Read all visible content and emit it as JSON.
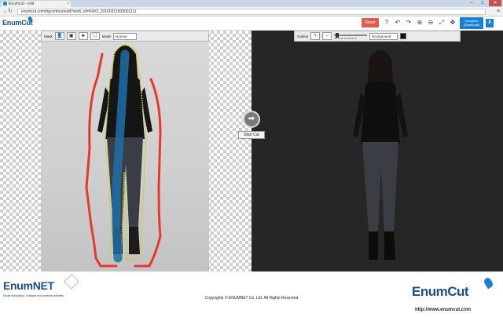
{
  "browser": {
    "tab_title": "Enumcut - edit",
    "tab_close": "×",
    "window_controls": {
      "minimize": "–",
      "maximize": "□",
      "close": "✕"
    },
    "nav": {
      "back": "←",
      "forward": "→",
      "reload": "↻"
    },
    "url": "enumcut.com/bgcontour/edit?work_id=NUKI_20160311500001111",
    "menu": "≡"
  },
  "app_header": {
    "logo": "EnumCut",
    "reset_label": "Reset",
    "icons": [
      "help-icon",
      "undo-icon",
      "redo-icon",
      "zoom-in-icon",
      "zoom-out-icon",
      "fit-icon",
      "move-icon"
    ],
    "icon_glyphs": {
      "help": "?",
      "undo": "↶",
      "redo": "↷",
      "zoom_in": "⊕",
      "zoom_out": "⊖",
      "fit": "⤢",
      "move": "✥"
    },
    "complete_label": "Complete",
    "complete_sub": "(Download)",
    "download_glyph": "⬇"
  },
  "left_toolbar": {
    "mask_label": "Mask",
    "buttons": [
      "person-icon",
      "eraser-icon",
      "fill-icon",
      "crop-icon"
    ],
    "button_glyphs": [
      "👤",
      "▣",
      "♣",
      "⛶"
    ],
    "mode_label": "Mode",
    "mode_value": "Normal"
  },
  "right_toolbar": {
    "outline_label": "Outline",
    "add_glyph": "+",
    "remove_glyph": "−",
    "slider_ticks": "10 15 20 25 30 35 40",
    "background_label": "Background",
    "background_color": "#111111"
  },
  "canvas": {
    "start_glyph": "➡",
    "start_label": "Start Cut",
    "stroke_colors": {
      "foreground": "#1f6fa8",
      "background": "#e8382b"
    }
  },
  "footer": {
    "enumnet_logo": "EnumNET",
    "enumnet_tagline": "Smart everything : software and creative activities",
    "copyright": "Copyrights © ENUMNET Co. Ltd. All Rights Reserved",
    "enumcut_logo": "EnumCut",
    "site_url": "http://www.enumcut.com"
  }
}
